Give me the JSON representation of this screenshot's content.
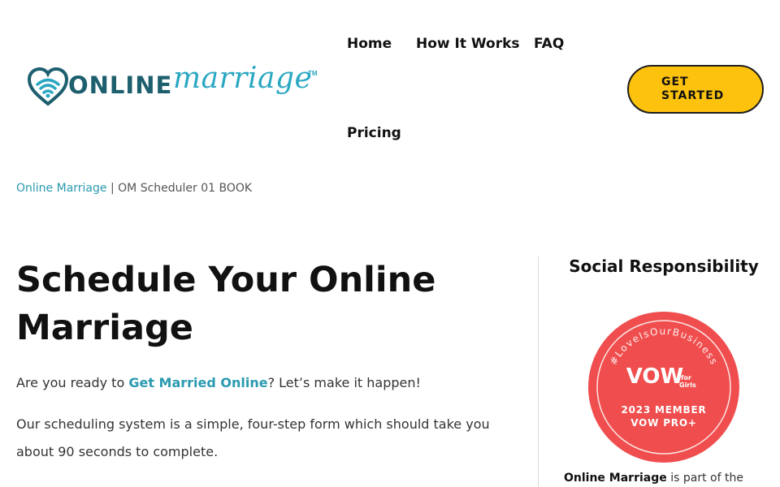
{
  "brand": {
    "wordmark": "ONLINE",
    "script": "marriage",
    "tm": "TM"
  },
  "nav": {
    "home": "Home",
    "how_it_works": "How It Works",
    "faq": "FAQ",
    "pricing": "Pricing"
  },
  "cta": {
    "line1": "GET",
    "line2": "STARTED"
  },
  "breadcrumb": {
    "home": "Online Marriage",
    "separator": " | ",
    "current": "OM Scheduler 01 BOOK"
  },
  "main": {
    "title": "Schedule Your Online Marriage",
    "intro_before": "Are you ready to ",
    "intro_link": "Get Married Online",
    "intro_after": "? Let’s make it happen!",
    "para2": "Our scheduling system is a simple, four-step form which should take you about 90 seconds to complete."
  },
  "sidebar": {
    "title": "Social Responsibility",
    "badge": {
      "arc_text": "#LoveIsOurBusiness",
      "logo_top": "VOW",
      "logo_for": "for",
      "logo_girls": "Girls",
      "line1": "2023 MEMBER",
      "line2": "VOW PRO+"
    },
    "text_strong": "Online Marriage",
    "text_rest": " is part of the"
  },
  "colors": {
    "teal_dark": "#1d5f6e",
    "teal": "#2aa7c2",
    "link": "#2a9ab0",
    "cta_yellow": "#fcc20e",
    "badge_red": "#f04e4e"
  }
}
